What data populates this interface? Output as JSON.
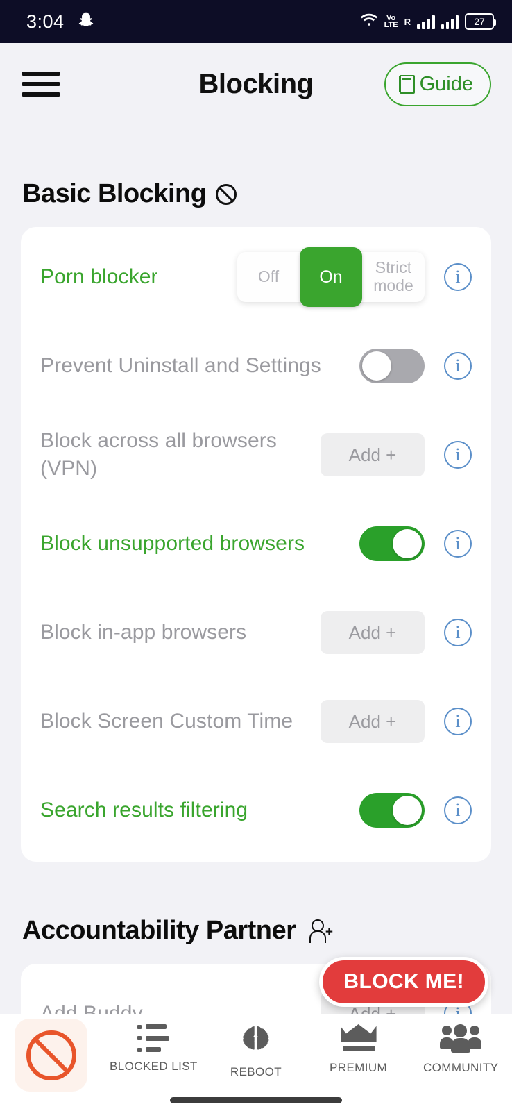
{
  "status_bar": {
    "time": "3:04",
    "app_icon": "snapchat-ghost-icon",
    "volte_label": "VoLTE",
    "roaming_label": "R",
    "battery_percent": "27"
  },
  "header": {
    "menu_icon": "hamburger-menu-icon",
    "title": "Blocking",
    "guide_label": "Guide",
    "guide_icon": "book-icon"
  },
  "basic_blocking": {
    "section_title": "Basic Blocking",
    "section_icon": "prohibition-icon",
    "rows": [
      {
        "label": "Porn blocker",
        "active": true,
        "control": "segmented",
        "segments": [
          "Off",
          "On",
          "Strict mode"
        ],
        "selected": "On",
        "info": "i"
      },
      {
        "label": "Prevent Uninstall and Settings",
        "active": false,
        "control": "toggle",
        "state": "off",
        "info": "i"
      },
      {
        "label": "Block across all browsers (VPN)",
        "active": false,
        "control": "add",
        "add_label": "Add +",
        "info": "i"
      },
      {
        "label": "Block unsupported browsers",
        "active": true,
        "control": "toggle",
        "state": "on",
        "info": "i"
      },
      {
        "label": "Block in-app browsers",
        "active": false,
        "control": "add",
        "add_label": "Add +",
        "info": "i"
      },
      {
        "label": "Block Screen Custom Time",
        "active": false,
        "control": "add",
        "add_label": "Add +",
        "info": "i"
      },
      {
        "label": "Search results filtering",
        "active": true,
        "control": "toggle",
        "state": "on",
        "info": "i"
      }
    ]
  },
  "accountability_partner": {
    "section_title": "Accountability Partner",
    "section_icon": "person-add-icon",
    "rows": [
      {
        "label": "Add Buddy",
        "control": "add",
        "add_label": "Add +",
        "info": "i"
      }
    ]
  },
  "block_me_button": {
    "label": "BLOCK ME!"
  },
  "bottom_nav": {
    "items": [
      {
        "label": "",
        "icon": "prohibition-icon",
        "active": true
      },
      {
        "label": "BLOCKED LIST",
        "icon": "list-icon",
        "active": false
      },
      {
        "label": "REBOOT",
        "icon": "brain-icon",
        "active": false
      },
      {
        "label": "PREMIUM",
        "icon": "crown-icon",
        "active": false
      },
      {
        "label": "COMMUNITY",
        "icon": "people-icon",
        "active": false
      }
    ]
  },
  "colors": {
    "accent_green": "#3aa52e",
    "toggle_on_green": "#2aa02a",
    "danger_red": "#e23c3c",
    "nav_active_orange": "#e8552b",
    "info_blue": "#5b8fc9",
    "muted_gray": "#9a9a9f",
    "page_background": "#f2f2f6",
    "status_bar_background": "#0d0d26"
  }
}
